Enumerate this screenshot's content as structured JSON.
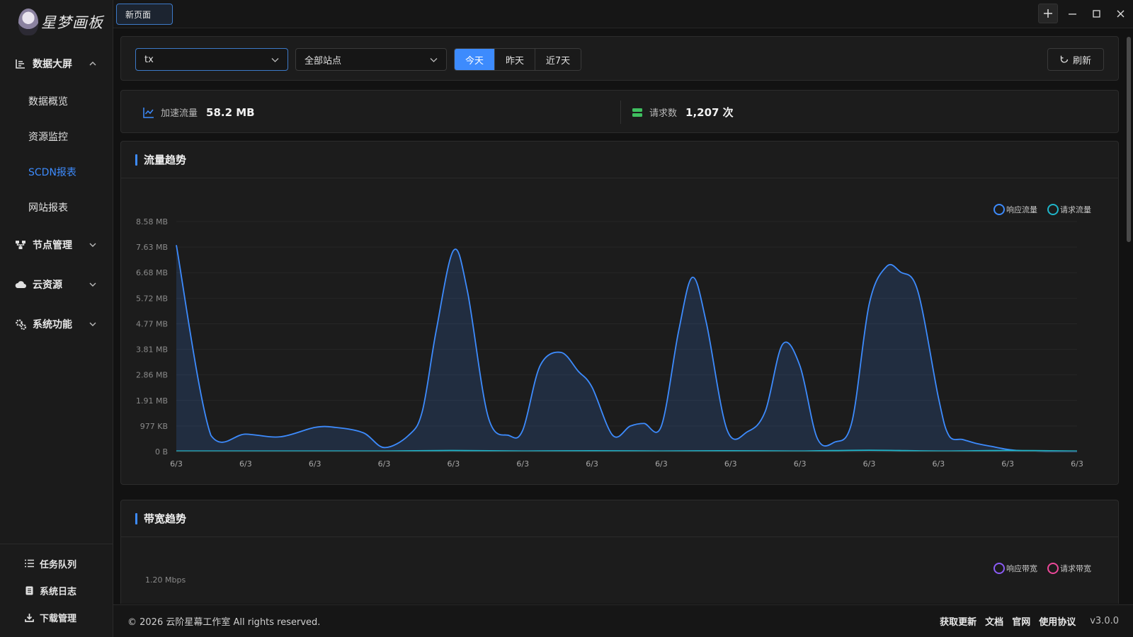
{
  "app": {
    "logo_text": "星梦画板"
  },
  "titlebar": {
    "tab_label": "新页面"
  },
  "sidebar": {
    "groups": [
      {
        "label": "数据大屏",
        "icon": "chart-icon",
        "expanded": true,
        "items": [
          {
            "label": "数据概览",
            "active": false
          },
          {
            "label": "资源监控",
            "active": false
          },
          {
            "label": "SCDN报表",
            "active": true
          },
          {
            "label": "网站报表",
            "active": false
          }
        ]
      },
      {
        "label": "节点管理",
        "icon": "nodes-icon",
        "expanded": false
      },
      {
        "label": "云资源",
        "icon": "cloud-icon",
        "expanded": false
      },
      {
        "label": "系统功能",
        "icon": "gears-icon",
        "expanded": false
      }
    ],
    "bottom": [
      {
        "label": "任务队列",
        "icon": "list-icon"
      },
      {
        "label": "系统日志",
        "icon": "log-icon"
      },
      {
        "label": "下载管理",
        "icon": "download-icon"
      }
    ]
  },
  "toolbar": {
    "user_select": "tx",
    "site_select": "全部站点",
    "range_options": [
      "今天",
      "昨天",
      "近7天"
    ],
    "range_selected": "今天",
    "refresh_label": "刷新"
  },
  "stats": {
    "traffic_label": "加速流量",
    "traffic_value": "58.2 MB",
    "requests_label": "请求数",
    "requests_value": "1,207 次"
  },
  "colors": {
    "accent": "#3d8bfd",
    "response": "#3d8bfd",
    "request": "#1fb5c9",
    "resp_bw": "#8b5cf6",
    "req_bw": "#ec4899",
    "stat_green": "#3fbf5f"
  },
  "traffic_chart": {
    "title": "流量趋势",
    "legend": [
      "响应流量",
      "请求流量"
    ]
  },
  "bandwidth_chart": {
    "title": "带宽趋势",
    "legend": [
      "响应带宽",
      "请求带宽"
    ],
    "first_tick": "1.20 Mbps"
  },
  "chart_data": {
    "type": "area",
    "yticks": [
      "0 B",
      "977 KB",
      "1.91 MB",
      "2.86 MB",
      "3.81 MB",
      "4.77 MB",
      "5.72 MB",
      "6.68 MB",
      "7.63 MB",
      "8.58 MB"
    ],
    "ylim_mb": [
      0,
      8.58
    ],
    "xticks": [
      "6/3",
      "6/3",
      "6/3",
      "6/3",
      "6/3",
      "6/3",
      "6/3",
      "6/3",
      "6/3",
      "6/3",
      "6/3",
      "6/3",
      "6/3",
      "6/3"
    ],
    "series": [
      {
        "name": "响应流量",
        "x": [
          0,
          0.5,
          1,
          1.5,
          2,
          2.3,
          2.7,
          3,
          3.35,
          3.55,
          3.75,
          4,
          4.2,
          4.5,
          4.8,
          5,
          5.25,
          5.55,
          5.8,
          6,
          6.3,
          6.55,
          6.75,
          7,
          7.25,
          7.45,
          7.65,
          7.95,
          8.25,
          8.5,
          8.75,
          9,
          9.25,
          9.5,
          9.75,
          10,
          10.25,
          10.45,
          10.7,
          11,
          11.15,
          11.35,
          11.55,
          11.75,
          11.95,
          12.1,
          12.3,
          12.55,
          12.8,
          13
        ],
        "values": [
          7.7,
          0.6,
          0.65,
          0.55,
          0.9,
          0.9,
          0.7,
          0.15,
          0.6,
          1.5,
          4.5,
          7.5,
          6.0,
          1.3,
          0.6,
          0.8,
          3.2,
          3.7,
          3.0,
          2.4,
          0.6,
          0.95,
          1.05,
          0.95,
          4.5,
          6.5,
          4.8,
          0.8,
          0.75,
          1.5,
          4.0,
          3.2,
          0.5,
          0.35,
          1.1,
          5.5,
          6.9,
          6.7,
          6.0,
          2.0,
          0.6,
          0.45,
          0.3,
          0.2,
          0.1,
          0.05,
          0.02,
          0.0,
          0.0,
          0.0
        ]
      },
      {
        "name": "请求流量",
        "x": [
          0,
          1,
          2,
          3,
          4,
          5,
          6,
          7,
          8,
          9,
          10,
          11,
          12,
          13
        ],
        "values": [
          0.02,
          0.02,
          0.02,
          0.02,
          0.04,
          0.02,
          0.03,
          0.02,
          0.03,
          0.02,
          0.05,
          0.02,
          0.04,
          0.02
        ]
      }
    ]
  },
  "footer": {
    "copyright": "© 2026 云阶星幕工作室 All rights reserved.",
    "links": [
      "获取更新",
      "文档",
      "官网",
      "使用协议"
    ],
    "version": "v3.0.0"
  }
}
